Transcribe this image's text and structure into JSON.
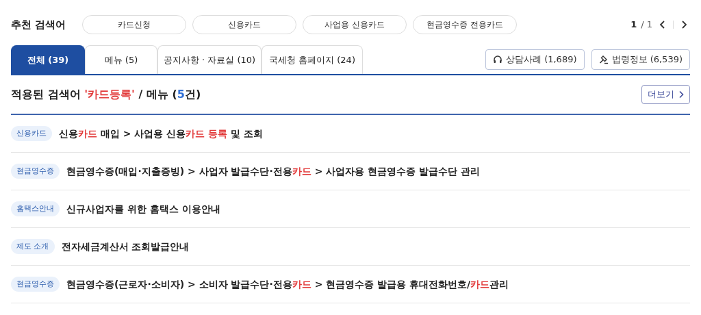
{
  "recommended": {
    "label": "추천 검색어",
    "keywords": [
      "카드신청",
      "신용카드",
      "사업용 신용카드",
      "현금영수증 전용카드"
    ],
    "page_current": "1",
    "page_total": "/ 1"
  },
  "tabs": [
    {
      "label": "전체 (39)",
      "selected": true
    },
    {
      "label": "메뉴 (5)",
      "selected": false
    },
    {
      "label": "공지사항 · 자료실 (10)",
      "selected": false
    },
    {
      "label": "국세청 홈페이지 (24)",
      "selected": false
    }
  ],
  "side_buttons": [
    {
      "kind": "headset",
      "label": "상담사례 (1,689)"
    },
    {
      "kind": "gavel",
      "label": "법령정보 (6,539)"
    }
  ],
  "heading": {
    "segments": [
      {
        "text": "적용된 검색어 "
      },
      {
        "text": "'카드등록'",
        "color": "#e23a3a"
      },
      {
        "text": " / 메뉴 ("
      },
      {
        "text": "5",
        "color": "#2f6fd6"
      },
      {
        "text": "건)"
      }
    ],
    "more_button": "더보기"
  },
  "results": [
    {
      "tag": "신용카드",
      "segments": [
        {
          "text": "신용"
        },
        {
          "text": "카드",
          "color": "#e23a3a"
        },
        {
          "text": " 매입 > 사업용 신용"
        },
        {
          "text": "카드 등록",
          "color": "#e23a3a"
        },
        {
          "text": " 및 조회"
        }
      ]
    },
    {
      "tag": "현금영수증",
      "segments": [
        {
          "text": "현금영수증(매입·지출증빙) > 사업자 발급수단·전용"
        },
        {
          "text": "카드",
          "color": "#e23a3a"
        },
        {
          "text": " > 사업자용 현금영수증 발급수단 관리"
        }
      ]
    },
    {
      "tag": "홈택스안내",
      "segments": [
        {
          "text": "신규사업자를 위한 홈택스 이용안내"
        }
      ]
    },
    {
      "tag": "제도 소개",
      "segments": [
        {
          "text": "전자세금계산서 조회발급안내"
        }
      ]
    },
    {
      "tag": "현금영수증",
      "segments": [
        {
          "text": "현금영수증(근로자·소비자) > 소비자 발급수단·전용"
        },
        {
          "text": "카드",
          "color": "#e23a3a"
        },
        {
          "text": " > 현금영수증 발급용 휴대전화번호/"
        },
        {
          "text": "카드",
          "color": "#e23a3a"
        },
        {
          "text": "관리"
        }
      ]
    }
  ]
}
